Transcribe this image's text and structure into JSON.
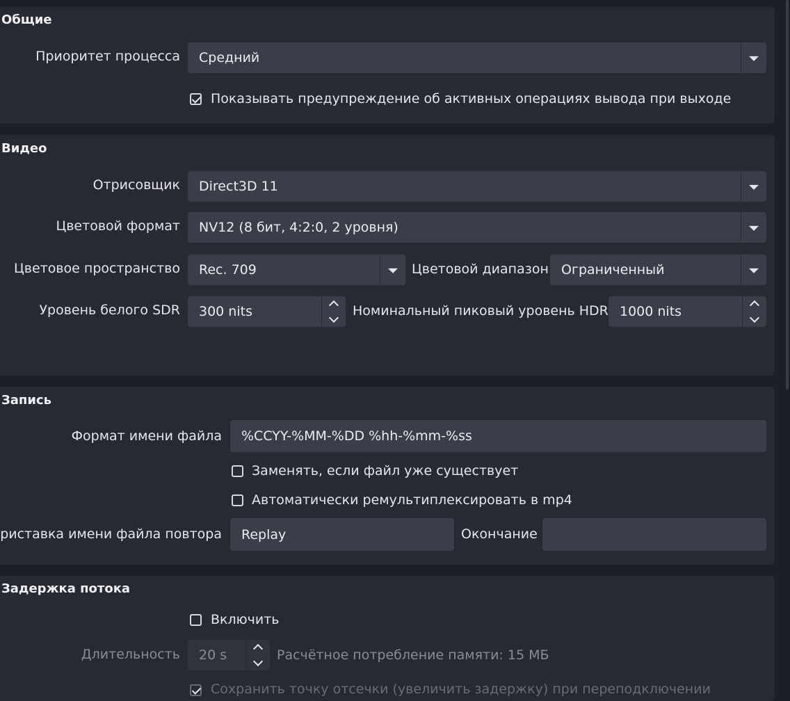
{
  "general": {
    "title": "Общие",
    "priority_label": "Приоритет процесса",
    "priority_value": "Средний",
    "warn_checkbox_label": "Показывать предупреждение об активных операциях вывода при выходе",
    "warn_checked": true
  },
  "video": {
    "title": "Видео",
    "renderer_label": "Отрисовщик",
    "renderer_value": "Direct3D 11",
    "color_format_label": "Цветовой формат",
    "color_format_value": "NV12 (8 бит, 4:2:0, 2 уровня)",
    "color_space_label": "Цветовое пространство",
    "color_space_value": "Rec. 709",
    "color_range_label": "Цветовой диапазон",
    "color_range_value": "Ограниченный",
    "sdr_white_label": "Уровень белого SDR",
    "sdr_white_value": "300 nits",
    "hdr_peak_label": "Номинальный пиковый уровень HDR",
    "hdr_peak_value": "1000 nits"
  },
  "recording": {
    "title": "Запись",
    "filename_format_label": "Формат имени файла",
    "filename_format_value": "%CCYY-%MM-%DD %hh-%mm-%ss",
    "overwrite_label": "Заменять, если файл уже существует",
    "overwrite_checked": false,
    "remux_label": "Автоматически ремультиплексировать в mp4",
    "remux_checked": false,
    "replay_prefix_label": "Приставка имени файла повтора",
    "replay_prefix_value": "Replay",
    "suffix_label": "Окончание",
    "suffix_value": ""
  },
  "stream_delay": {
    "title": "Задержка потока",
    "enable_label": "Включить",
    "enable_checked": false,
    "duration_label": "Длительность",
    "duration_value": "20 s",
    "memory_estimate": "Расчётное потребление памяти: 15 МБ",
    "preserve_cutoff_label": "Сохранить точку отсечки (увеличить задержку) при переподключении",
    "preserve_cutoff_checked": true
  }
}
